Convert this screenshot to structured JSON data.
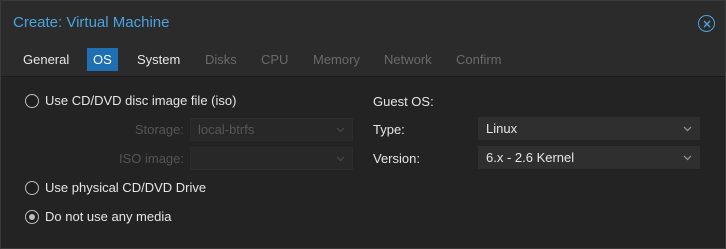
{
  "window": {
    "title": "Create: Virtual Machine"
  },
  "tabs": [
    {
      "label": "General",
      "state": "normal"
    },
    {
      "label": "OS",
      "state": "active"
    },
    {
      "label": "System",
      "state": "normal"
    },
    {
      "label": "Disks",
      "state": "disabled"
    },
    {
      "label": "CPU",
      "state": "disabled"
    },
    {
      "label": "Memory",
      "state": "disabled"
    },
    {
      "label": "Network",
      "state": "disabled"
    },
    {
      "label": "Confirm",
      "state": "disabled"
    }
  ],
  "media": {
    "iso_option": "Use CD/DVD disc image file (iso)",
    "storage_label": "Storage:",
    "storage_value": "local-btrfs",
    "iso_image_label": "ISO image:",
    "iso_image_value": "",
    "physical_option": "Use physical CD/DVD Drive",
    "no_media_option": "Do not use any media",
    "selected": "no_media"
  },
  "guest_os": {
    "title": "Guest OS:",
    "type_label": "Type:",
    "type_value": "Linux",
    "version_label": "Version:",
    "version_value": "6.x - 2.6 Kernel"
  },
  "colors": {
    "accent": "#4aa3df",
    "active_tab": "#1f6fb3"
  }
}
